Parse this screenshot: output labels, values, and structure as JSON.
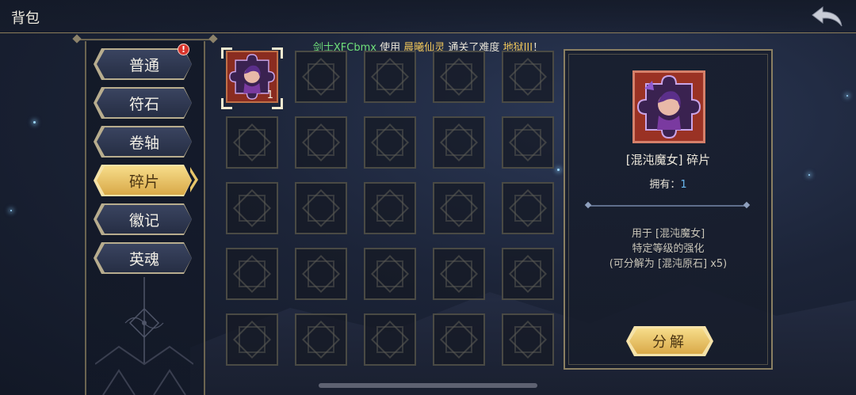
{
  "header": {
    "title": "背包",
    "back_icon": "back-arrow-icon"
  },
  "announcement": {
    "player": "剑士XFCbmx",
    "use_text": "使用",
    "hero": "晨曦仙灵",
    "pass_text": "通关了难度",
    "difficulty": "地狱III",
    "end": "！"
  },
  "tabs": [
    {
      "label": "普通",
      "active": false,
      "badge": "!"
    },
    {
      "label": "符石",
      "active": false
    },
    {
      "label": "卷轴",
      "active": false
    },
    {
      "label": "碎片",
      "active": true
    },
    {
      "label": "徽记",
      "active": false
    },
    {
      "label": "英魂",
      "active": false
    }
  ],
  "grid": {
    "rows": 5,
    "cols": 5,
    "items": [
      {
        "index": 0,
        "name": "混沌魔女碎片",
        "count": "1",
        "selected": true
      }
    ]
  },
  "detail": {
    "name": "[混沌魔女] 碎片",
    "own_label": "拥有：",
    "own_count": "1",
    "desc_lines": [
      "用于 [混沌魔女]",
      "特定等级的强化",
      "(可分解为 [混沌原石] x5)"
    ],
    "action_label": "分解"
  },
  "colors": {
    "accent_gold": "#f0c65a",
    "player_green": "#6fe07a",
    "count_blue": "#6ab8f0",
    "fragment_red": "#9a3224"
  }
}
